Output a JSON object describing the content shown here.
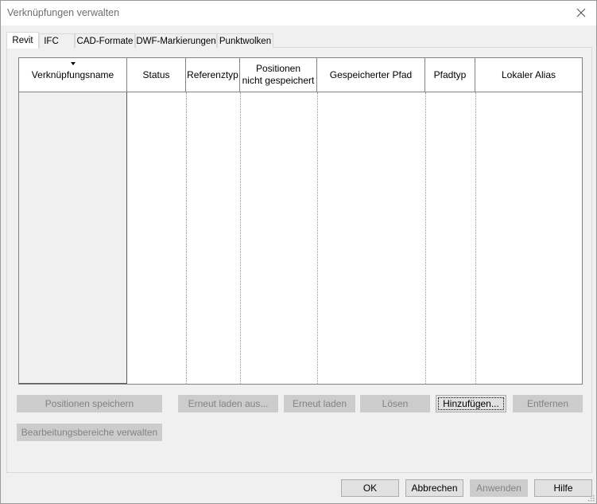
{
  "window": {
    "title": "Verknüpfungen verwalten",
    "close_icon": "close-icon"
  },
  "tabs": [
    {
      "label": "Revit",
      "active": true
    },
    {
      "label": "IFC",
      "active": false
    },
    {
      "label": "CAD-Formate",
      "active": false
    },
    {
      "label": "DWF-Markierungen",
      "active": false
    },
    {
      "label": "Punktwolken",
      "active": false
    }
  ],
  "table": {
    "columns": [
      "Verknüpfungsname",
      "Status",
      "Referenztyp",
      "Positionen nicht gespeichert",
      "Gespeicherter Pfad",
      "Pfadtyp",
      "Lokaler Alias"
    ],
    "columns_line2": {
      "positions_line1": "Positionen",
      "positions_line2": "nicht gespeichert"
    },
    "sort_icon": "sort-descending-icon",
    "rows": []
  },
  "actions": {
    "save_positions": "Positionen speichern",
    "reload_from": "Erneut laden aus...",
    "reload": "Erneut laden",
    "unload": "Lösen",
    "add": "Hinzufügen...",
    "remove": "Entfernen",
    "manage_worksets": "Bearbeitungsbereiche verwalten"
  },
  "footer": {
    "ok": "OK",
    "cancel": "Abbrechen",
    "apply": "Anwenden",
    "help": "Hilfe"
  },
  "colors": {
    "dialog_bg": "#f0f0f0",
    "disabled_btn": "#cccccc",
    "enabled_btn": "#e1e1e1"
  }
}
